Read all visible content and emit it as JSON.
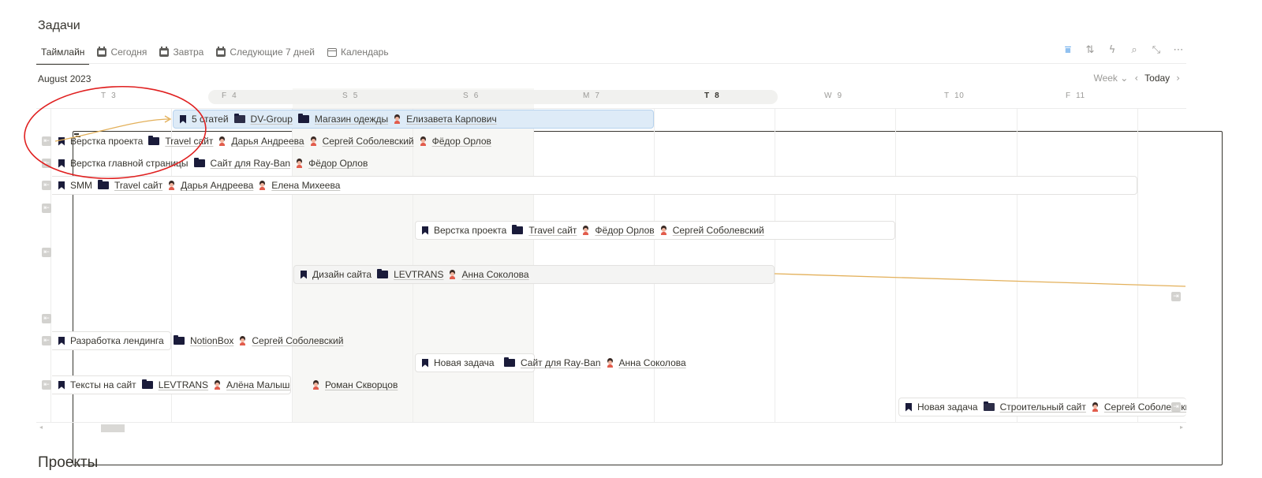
{
  "sections": {
    "tasks_title": "Задачи",
    "projects_title": "Проекты"
  },
  "tabs": [
    {
      "label": "Таймлайн",
      "icon": "timeline-icon",
      "active": true
    },
    {
      "label": "Сегодня",
      "icon": "calendar-day-icon"
    },
    {
      "label": "Завтра",
      "icon": "calendar-day-icon"
    },
    {
      "label": "Следующие 7 дней",
      "icon": "calendar-day-icon"
    },
    {
      "label": "Календарь",
      "icon": "calendar-icon"
    }
  ],
  "toolbar": [
    "filter-icon",
    "sort-icon",
    "lightning-icon",
    "search-icon",
    "expand-icon",
    "more-icon"
  ],
  "timeline": {
    "month": "August 2023",
    "view": "Week",
    "today_label": "Today",
    "days": [
      {
        "dow": "T",
        "num": "3"
      },
      {
        "dow": "F",
        "num": "4"
      },
      {
        "dow": "S",
        "num": "5"
      },
      {
        "dow": "S",
        "num": "6"
      },
      {
        "dow": "M",
        "num": "7"
      },
      {
        "dow": "T",
        "num": "8",
        "today": true
      },
      {
        "dow": "W",
        "num": "9"
      },
      {
        "dow": "T",
        "num": "10"
      },
      {
        "dow": "F",
        "num": "11"
      }
    ]
  },
  "tasks": [
    {
      "name": "5 статей",
      "project": "DV-Group",
      "client": "Магазин одежды",
      "people": [
        "Елизавета Карпович"
      ]
    },
    {
      "name": "Верстка проекта",
      "project": "Travel сайт",
      "people": [
        "Дарья Андреева",
        "Сергей Соболевский",
        "Фёдор Орлов"
      ]
    },
    {
      "name": "Верстка главной страницы",
      "project": "Сайт для Ray-Ban",
      "people": [
        "Фёдор Орлов"
      ]
    },
    {
      "name": "SMM",
      "project": "Travel сайт",
      "people": [
        "Дарья Андреева",
        "Елена Михеева"
      ]
    },
    {
      "name": "Верстка проекта",
      "project": "Travel сайт",
      "people": [
        "Фёдор Орлов",
        "Сергей Соболевский"
      ]
    },
    {
      "name": "Дизайн сайта",
      "project": "LEVTRANS",
      "people": [
        "Анна Соколова"
      ]
    },
    {
      "name": "Разработка лендинга",
      "project": "NotionBox",
      "people": [
        "Сергей Соболевский"
      ]
    },
    {
      "name": "Новая задача",
      "project": "Сайт для Ray-Ban",
      "people": [
        "Анна Соколова"
      ]
    },
    {
      "name": "Тексты на сайт",
      "project": "LEVTRANS",
      "people": [
        "Алёна Малышева",
        "Роман Скворцов"
      ]
    },
    {
      "name": "Новая задача",
      "project": "Строительный сайт",
      "people": [
        "Сергей Соболевский"
      ]
    }
  ],
  "colors": {
    "accent": "#2383e2",
    "selected_bg": "#deebf7",
    "dependency_line": "#e3b05a",
    "annotation": "#e02020"
  }
}
